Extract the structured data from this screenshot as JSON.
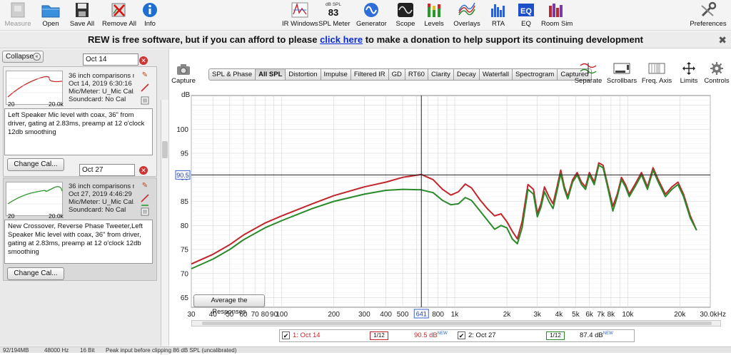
{
  "toolbar": {
    "left": [
      {
        "label": "Measure",
        "icon": "measure-icon",
        "disabled": true
      },
      {
        "label": "Open",
        "icon": "open-folder-icon"
      },
      {
        "label": "Save All",
        "icon": "save-disk-icon"
      },
      {
        "label": "Remove All",
        "icon": "remove-all-icon"
      },
      {
        "label": "Info",
        "icon": "info-icon"
      }
    ],
    "center": [
      {
        "label": "IR Windows",
        "icon": "ir-windows-icon"
      },
      {
        "label": "SPL Meter",
        "icon": "spl-meter-icon",
        "readout_top": "dB SPL",
        "readout_value": "83"
      },
      {
        "label": "Generator",
        "icon": "generator-icon"
      },
      {
        "label": "Scope",
        "icon": "scope-icon"
      },
      {
        "label": "Levels",
        "icon": "levels-icon"
      },
      {
        "label": "Overlays",
        "icon": "overlays-icon"
      },
      {
        "label": "RTA",
        "icon": "rta-icon"
      },
      {
        "label": "EQ",
        "icon": "eq-icon"
      },
      {
        "label": "Room Sim",
        "icon": "room-sim-icon"
      }
    ],
    "right": {
      "label": "Preferences",
      "icon": "preferences-icon"
    }
  },
  "banner": {
    "pre": "REW is free software, but if you can afford to please ",
    "link": "click here",
    "post": " to make a donation to help support its continuing development",
    "close": "✖"
  },
  "left_panel": {
    "collapse_label": "Collapse",
    "measurements": [
      {
        "number": "1",
        "name": "Oct 14",
        "info": [
          "36 inch comparisons no",
          "Oct 14, 2019 6:30:16 PM",
          "Mic/Meter: U_Mic Cal.txt",
          "Soundcard: No Cal"
        ],
        "thumb_x_min": "20",
        "thumb_x_max": "20.0k",
        "color": "#cc2a2a",
        "notes": "Left Speaker Mic level with coax, 36\" from driver, gating at 2.83ms, preamp at 12 o'clock 12db smoothing",
        "change_cal": "Change Cal..."
      },
      {
        "number": "2",
        "name": "Oct 27",
        "info": [
          "36 inch comparisons no",
          "Oct 27, 2019 4:46:29 PM",
          "Mic/Meter: U_Mic Cal.txt",
          "Soundcard: No Cal"
        ],
        "thumb_x_min": "20",
        "thumb_x_max": "20.0k",
        "color": "#2a9a2a",
        "notes": "New Crossover, Reverse Phase Tweeter,Left Speaker Mic level with coax, 36\" from driver, gating at 2.83ms, preamp at 12 o'clock 12db smoothing",
        "change_cal": "Change Cal..."
      }
    ]
  },
  "graph": {
    "capture_label": "Capture",
    "tabs": [
      "SPL & Phase",
      "All SPL",
      "Distortion",
      "Impulse",
      "Filtered IR",
      "GD",
      "RT60",
      "Clarity",
      "Decay",
      "Waterfall",
      "Spectrogram",
      "Captured"
    ],
    "active_tab": "All SPL",
    "controls": [
      {
        "label": "Separate",
        "icon": "separate-icon"
      },
      {
        "label": "Scrollbars",
        "icon": "scrollbars-icon"
      },
      {
        "label": "Freq. Axis",
        "icon": "freq-axis-icon"
      },
      {
        "label": "Limits",
        "icon": "limits-icon"
      },
      {
        "label": "Controls",
        "icon": "controls-gear-icon"
      }
    ],
    "average_button": "Average the Responses",
    "cursor_x_label": "641",
    "cursor_y_label": "90.5"
  },
  "chart_data": {
    "type": "line",
    "x_scale": "log",
    "xlim": [
      30,
      30000
    ],
    "ylim": [
      63,
      107
    ],
    "ylabel": "dB",
    "y_ticks": [
      65,
      70,
      75,
      80,
      85,
      90,
      95,
      100
    ],
    "x_ticks": [
      {
        "v": 30,
        "l": "30"
      },
      {
        "v": 40,
        "l": "40"
      },
      {
        "v": 50,
        "l": "50"
      },
      {
        "v": 60,
        "l": "60"
      },
      {
        "v": 70,
        "l": "70"
      },
      {
        "v": 80,
        "l": "80"
      },
      {
        "v": 90,
        "l": "90"
      },
      {
        "v": 100,
        "l": "100"
      },
      {
        "v": 200,
        "l": "200"
      },
      {
        "v": 300,
        "l": "300"
      },
      {
        "v": 400,
        "l": "400"
      },
      {
        "v": 500,
        "l": "500"
      },
      {
        "v": 600,
        "l": "6"
      },
      {
        "v": 800,
        "l": "800"
      },
      {
        "v": 1000,
        "l": "1k"
      },
      {
        "v": 2000,
        "l": "2k"
      },
      {
        "v": 3000,
        "l": "3k"
      },
      {
        "v": 4000,
        "l": "4k"
      },
      {
        "v": 5000,
        "l": "5k"
      },
      {
        "v": 6000,
        "l": "6k"
      },
      {
        "v": 7000,
        "l": "7k"
      },
      {
        "v": 8000,
        "l": "8k"
      },
      {
        "v": 10000,
        "l": "10k"
      },
      {
        "v": 20000,
        "l": "20k"
      },
      {
        "v": 30000,
        "l": "30.0kHz"
      }
    ],
    "cursor_x": 641,
    "cursor_y": 90.5,
    "series": [
      {
        "name": "1: Oct 14",
        "color": "#c0262c",
        "points": [
          [
            30,
            72
          ],
          [
            40,
            74
          ],
          [
            50,
            76
          ],
          [
            60,
            78
          ],
          [
            80,
            80.5
          ],
          [
            100,
            82
          ],
          [
            150,
            84.5
          ],
          [
            200,
            86.2
          ],
          [
            300,
            88
          ],
          [
            400,
            89
          ],
          [
            500,
            90
          ],
          [
            641,
            90.6
          ],
          [
            750,
            89.5
          ],
          [
            850,
            87.5
          ],
          [
            950,
            86.3
          ],
          [
            1050,
            87
          ],
          [
            1150,
            88.6
          ],
          [
            1250,
            87.8
          ],
          [
            1400,
            85.3
          ],
          [
            1550,
            83.4
          ],
          [
            1700,
            82
          ],
          [
            1850,
            82.4
          ],
          [
            2000,
            80.8
          ],
          [
            2150,
            78.8
          ],
          [
            2300,
            77.2
          ],
          [
            2450,
            80.8
          ],
          [
            2650,
            88.5
          ],
          [
            2850,
            87.5
          ],
          [
            3000,
            82.5
          ],
          [
            3150,
            84.5
          ],
          [
            3300,
            88
          ],
          [
            3500,
            86
          ],
          [
            3700,
            84.5
          ],
          [
            3900,
            88
          ],
          [
            4100,
            91.5
          ],
          [
            4300,
            88
          ],
          [
            4500,
            86
          ],
          [
            4800,
            89.5
          ],
          [
            5100,
            91
          ],
          [
            5400,
            89
          ],
          [
            5700,
            88
          ],
          [
            6000,
            91
          ],
          [
            6400,
            89
          ],
          [
            6800,
            93
          ],
          [
            7200,
            92.5
          ],
          [
            7700,
            88
          ],
          [
            8200,
            84
          ],
          [
            8700,
            86.5
          ],
          [
            9200,
            90
          ],
          [
            9700,
            88.5
          ],
          [
            10200,
            86.5
          ],
          [
            11000,
            88.5
          ],
          [
            12000,
            91
          ],
          [
            13000,
            88
          ],
          [
            14000,
            92
          ],
          [
            15000,
            89.5
          ],
          [
            16500,
            86.5
          ],
          [
            18000,
            88
          ],
          [
            19500,
            89
          ],
          [
            21000,
            86.5
          ],
          [
            23000,
            82
          ],
          [
            25000,
            79
          ]
        ]
      },
      {
        "name": "2: Oct 27",
        "color": "#2a8a2a",
        "points": [
          [
            30,
            71
          ],
          [
            40,
            73
          ],
          [
            50,
            75
          ],
          [
            60,
            77
          ],
          [
            80,
            79.5
          ],
          [
            100,
            81
          ],
          [
            150,
            83.5
          ],
          [
            200,
            85
          ],
          [
            300,
            86.5
          ],
          [
            400,
            87.3
          ],
          [
            500,
            87.5
          ],
          [
            641,
            87.4
          ],
          [
            750,
            86.8
          ],
          [
            850,
            85.2
          ],
          [
            950,
            84.3
          ],
          [
            1050,
            84.5
          ],
          [
            1150,
            85.8
          ],
          [
            1250,
            85.2
          ],
          [
            1400,
            83
          ],
          [
            1550,
            81
          ],
          [
            1700,
            79.2
          ],
          [
            1850,
            80
          ],
          [
            2000,
            79.5
          ],
          [
            2150,
            77.2
          ],
          [
            2300,
            76.2
          ],
          [
            2450,
            79.5
          ],
          [
            2650,
            87.5
          ],
          [
            2850,
            86.5
          ],
          [
            3000,
            81.8
          ],
          [
            3150,
            83.8
          ],
          [
            3300,
            87
          ],
          [
            3500,
            85
          ],
          [
            3700,
            83.5
          ],
          [
            3900,
            87.2
          ],
          [
            4100,
            90.8
          ],
          [
            4300,
            87.5
          ],
          [
            4500,
            85.5
          ],
          [
            4800,
            89
          ],
          [
            5100,
            90.5
          ],
          [
            5400,
            88.5
          ],
          [
            5700,
            87.5
          ],
          [
            6000,
            90.5
          ],
          [
            6400,
            88.5
          ],
          [
            6800,
            92.5
          ],
          [
            7200,
            92
          ],
          [
            7700,
            87.5
          ],
          [
            8200,
            83
          ],
          [
            8700,
            86
          ],
          [
            9200,
            89.5
          ],
          [
            9700,
            88
          ],
          [
            10200,
            86
          ],
          [
            11000,
            88
          ],
          [
            12000,
            90.5
          ],
          [
            13000,
            87.5
          ],
          [
            14000,
            91.5
          ],
          [
            15000,
            89
          ],
          [
            16500,
            86
          ],
          [
            18000,
            87.5
          ],
          [
            19500,
            88.5
          ],
          [
            21000,
            86
          ],
          [
            23000,
            81.5
          ],
          [
            25000,
            79
          ]
        ]
      }
    ]
  },
  "legend": {
    "items": [
      {
        "name": "1: Oct 14",
        "smoothing": "1/12",
        "value": "90.5 dB",
        "sup": "NEW",
        "color": "#c0262c"
      },
      {
        "name": "2: Oct 27",
        "smoothing": "1/12",
        "value": "87.4 dB",
        "sup": "NEW",
        "color": "#2a8a2a"
      }
    ]
  },
  "status_bar": {
    "memory": "92/194MB",
    "sample_rate": "48000 Hz",
    "bit_depth": "16 Bit",
    "message": "Peak input before clipping 86 dB SPL (uncalibrated)"
  }
}
